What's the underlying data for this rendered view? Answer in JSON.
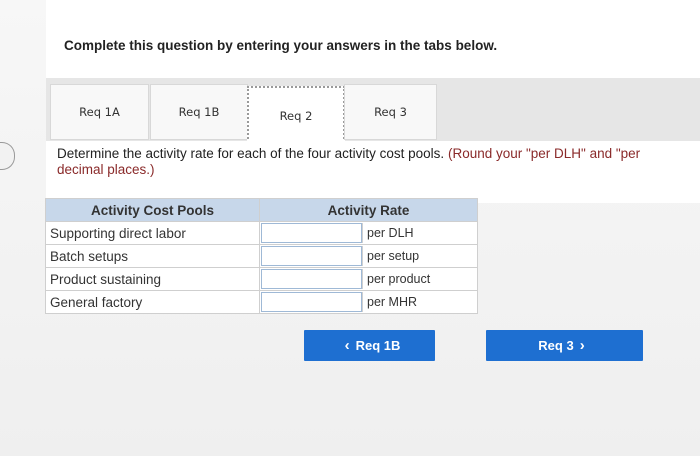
{
  "instruction": "Complete this question by entering your answers in the tabs below.",
  "tabs": [
    {
      "label": "Req 1A"
    },
    {
      "label": "Req 1B"
    },
    {
      "label": "Req 2"
    },
    {
      "label": "Req 3"
    }
  ],
  "question": {
    "text": "Determine the activity rate for each of the four activity cost pools.",
    "note": "(Round your \"per DLH\" and \"per",
    "note_cont": "decimal places.)"
  },
  "table": {
    "header_pools": "Activity Cost Pools",
    "header_rate": "Activity Rate",
    "rows": [
      {
        "pool": "Supporting direct labor",
        "unit": "per DLH"
      },
      {
        "pool": "Batch setups",
        "unit": "per setup"
      },
      {
        "pool": "Product sustaining",
        "unit": "per product"
      },
      {
        "pool": "General factory",
        "unit": "per MHR"
      }
    ]
  },
  "nav": {
    "prev_label": "Req 1B",
    "next_label": "Req 3",
    "prev_chevron": "‹",
    "next_chevron": "›"
  },
  "colors": {
    "button_blue": "#1e6fd1",
    "table_header": "#c7d7ea"
  }
}
